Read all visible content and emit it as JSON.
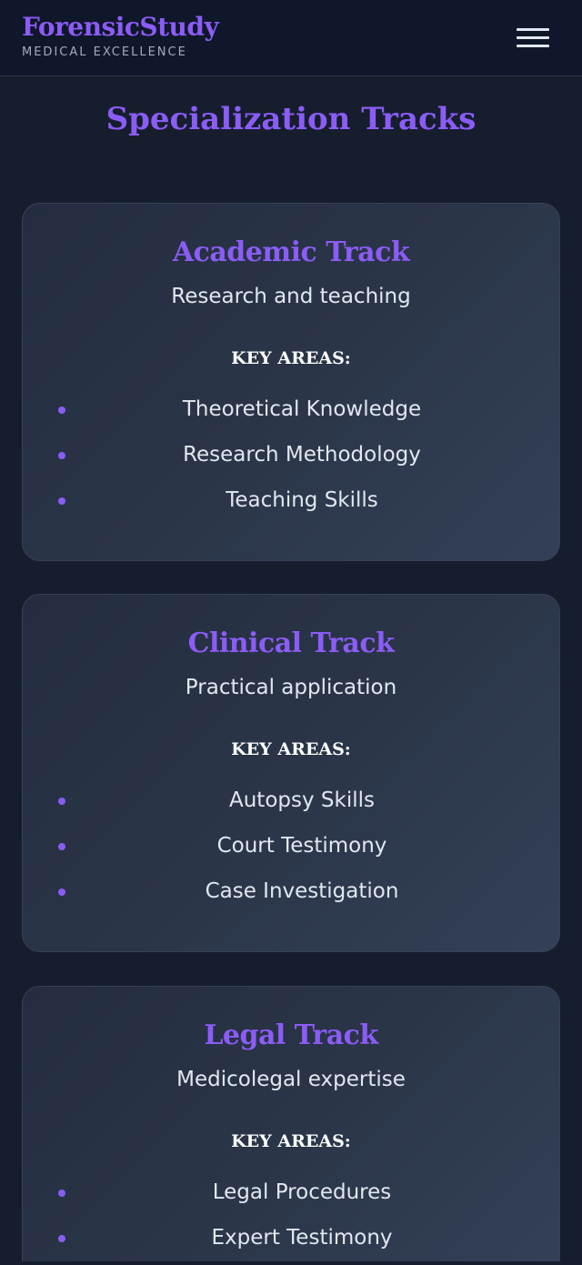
{
  "header": {
    "brand_name": "ForensicStudy",
    "brand_tagline": "MEDICAL EXCELLENCE",
    "menu_icon": "hamburger-menu-icon"
  },
  "page": {
    "title": "Specialization Tracks"
  },
  "colors": {
    "accent": "#8b5cf6",
    "background": "#161e2e",
    "header_bg": "#0f172a",
    "card_border": "#364256",
    "text": "#e2e8f0"
  },
  "tracks": [
    {
      "title": "Academic Track",
      "subtitle": "Research and teaching",
      "key_label": "KEY AREAS:",
      "areas": [
        "Theoretical Knowledge",
        "Research Methodology",
        "Teaching Skills"
      ]
    },
    {
      "title": "Clinical Track",
      "subtitle": "Practical application",
      "key_label": "KEY AREAS:",
      "areas": [
        "Autopsy Skills",
        "Court Testimony",
        "Case Investigation"
      ]
    },
    {
      "title": "Legal Track",
      "subtitle": "Medicolegal expertise",
      "key_label": "KEY AREAS:",
      "areas": [
        "Legal Procedures",
        "Expert Testimony"
      ]
    }
  ]
}
